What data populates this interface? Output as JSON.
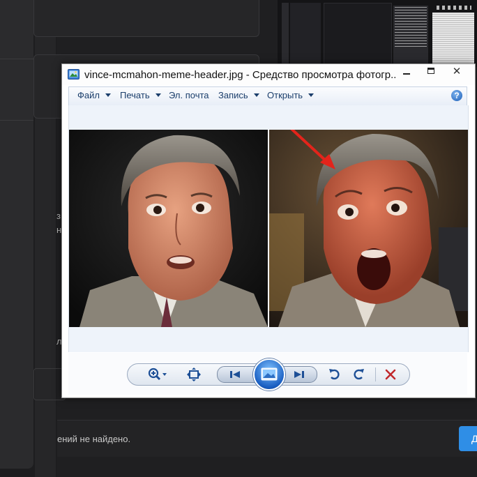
{
  "background": {
    "status_text": "ений не найдено.",
    "side_chars": [
      "з",
      "н",
      "л"
    ],
    "blue_button_label": "Д"
  },
  "viewer": {
    "title": "vince-mcmahon-meme-header.jpg - Средство просмотра фотогр...",
    "window_buttons": {
      "minimize": "minimize-icon",
      "maximize": "maximize-icon",
      "close": "✕"
    },
    "menu": [
      {
        "label": "Файл",
        "has_dropdown": true
      },
      {
        "label": "Печать",
        "has_dropdown": true
      },
      {
        "label": "Эл. почта",
        "has_dropdown": false
      },
      {
        "label": "Запись",
        "has_dropdown": true
      },
      {
        "label": "Открыть",
        "has_dropdown": true
      }
    ],
    "help_label": "?",
    "toolbar": {
      "buttons": [
        "zoom-icon",
        "fit-window-icon",
        "previous-icon",
        "slideshow-icon",
        "next-icon",
        "rotate-left-icon",
        "rotate-right-icon",
        "delete-icon"
      ],
      "accent": "#1a5fc2",
      "delete_color": "#c0282c"
    }
  }
}
